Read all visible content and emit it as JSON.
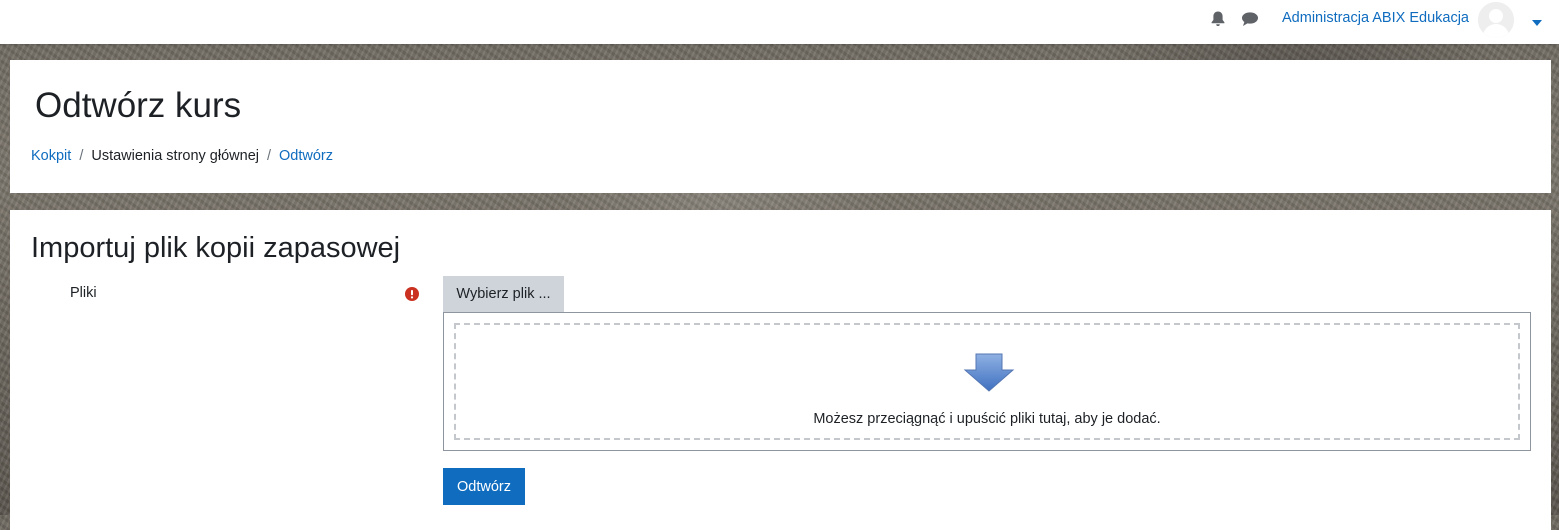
{
  "navbar": {
    "icons": {
      "notifications": "bell-icon",
      "messages": "chat-icon",
      "user_menu": "caret-down-icon"
    },
    "user_name": "Administracja ABIX Edukacja"
  },
  "header": {
    "title": "Odtwórz kurs",
    "breadcrumb": [
      {
        "label": "Kokpit",
        "link": true
      },
      {
        "label": "Ustawienia strony głównej",
        "link": false
      },
      {
        "label": "Odtwórz",
        "link": true
      }
    ]
  },
  "main": {
    "section_title": "Importuj plik kopii zapasowej",
    "files_field": {
      "label": "Pliki",
      "required_icon": "exclamation-circle-icon",
      "choose_button": "Wybierz plik ...",
      "drop_icon": "arrow-down-icon",
      "drop_hint": "Możesz przeciągnąć i upuścić pliki tutaj, aby je dodać."
    },
    "restore_button": "Odtwórz"
  },
  "colors": {
    "accent": "#0f6cbf",
    "required": "#ca3120",
    "button_secondary": "#ced4da"
  }
}
